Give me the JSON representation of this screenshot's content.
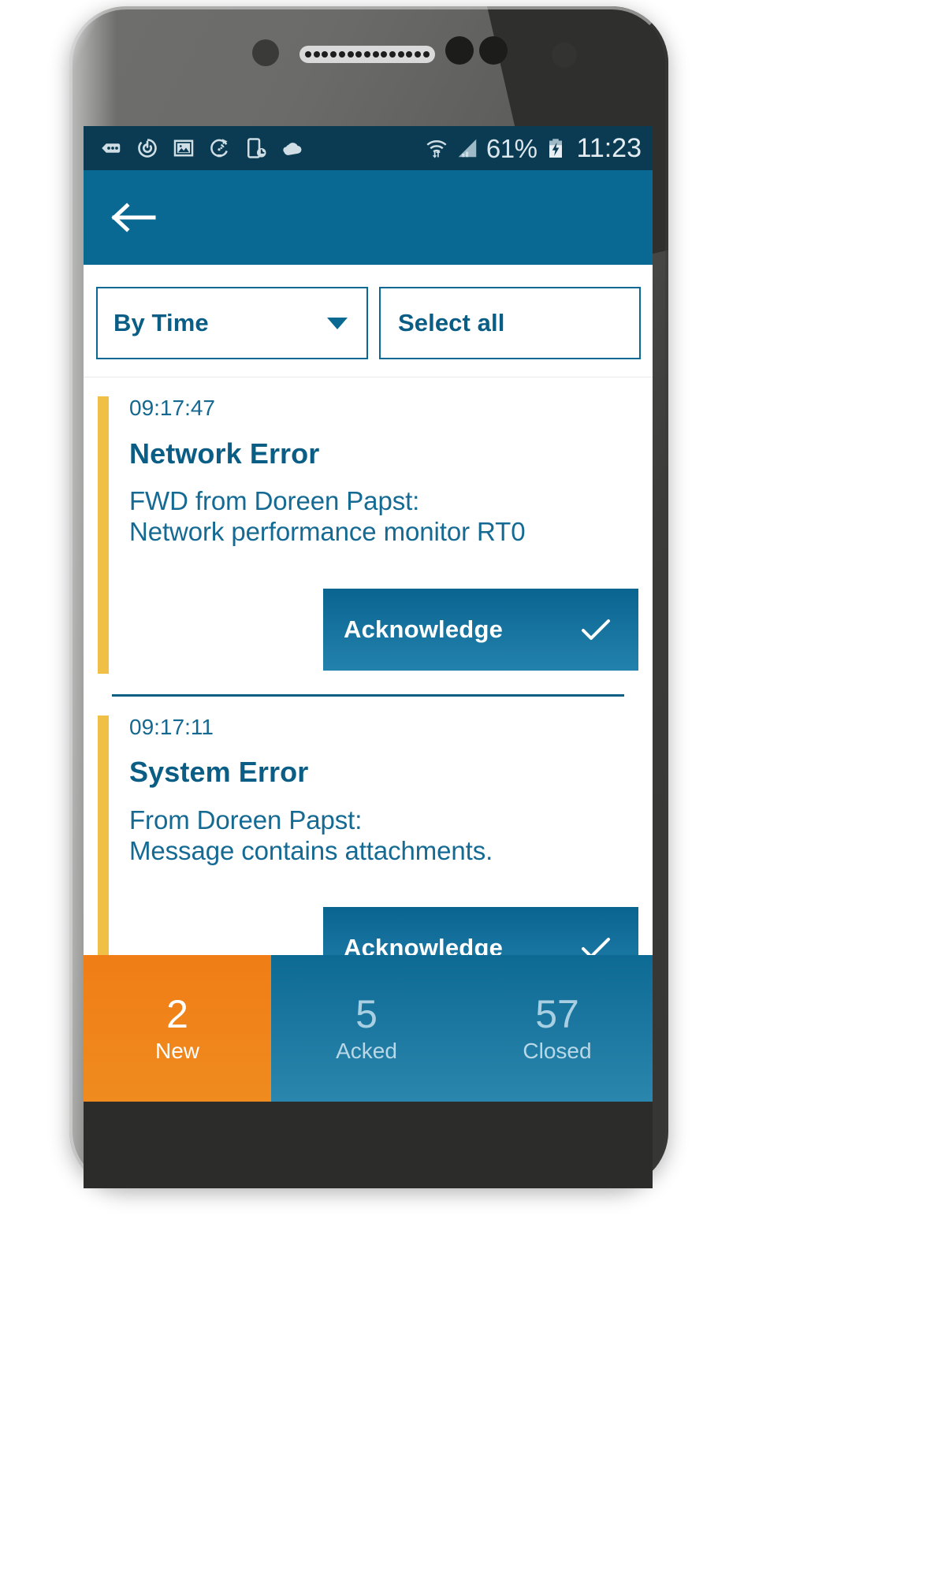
{
  "device": {
    "name": "android-smartphone",
    "earpiece_dots": 15
  },
  "statusbar": {
    "icons": [
      {
        "name": "messages-icon",
        "glyph": "messages"
      },
      {
        "name": "power-circle-icon",
        "glyph": "power"
      },
      {
        "name": "gallery-image-icon",
        "glyph": "image"
      },
      {
        "name": "sync-rotate-icon",
        "glyph": "sync"
      },
      {
        "name": "device-clock-icon",
        "glyph": "device-clock"
      },
      {
        "name": "cloud-icon",
        "glyph": "cloud"
      }
    ],
    "wifi": "wifi-transfer-icon",
    "signal": "cellular-signal-icon",
    "battery_percent": "61%",
    "battery_state": "charging",
    "time": "11:23"
  },
  "appbar": {
    "back": "back-arrow",
    "title": "",
    "bg_color": "#0a6992"
  },
  "filterbar": {
    "sort": {
      "label": "By Time",
      "caret": "chevron-down-icon"
    },
    "select_all": {
      "label": "Select all"
    }
  },
  "alerts": [
    {
      "time": "09:17:47",
      "title": "Network Error",
      "text": "FWD from Doreen Papst:\nNetwork performance monitor RT0",
      "accent_color": "#f0bf46",
      "action": {
        "label": "Acknowledge",
        "icon": "check-icon"
      }
    },
    {
      "time": "09:17:11",
      "title": "System Error",
      "text": "From Doreen Papst:\nMessage contains attachments.",
      "accent_color": "#f0bf46",
      "action": {
        "label": "Acknowledge",
        "icon": "check-icon"
      }
    }
  ],
  "tabs": [
    {
      "count": "2",
      "label": "New",
      "active": true,
      "color": "#f07d16"
    },
    {
      "count": "5",
      "label": "Acked",
      "active": false,
      "color": "#0d6a93"
    },
    {
      "count": "57",
      "label": "Closed",
      "active": false,
      "color": "#0d6a93"
    }
  ],
  "colors": {
    "brand_blue": "#0a6992",
    "dark_blue": "#0b3b52",
    "text_blue": "#0a5d85",
    "accent_amber": "#f0bf46",
    "accent_orange": "#f07d16"
  }
}
